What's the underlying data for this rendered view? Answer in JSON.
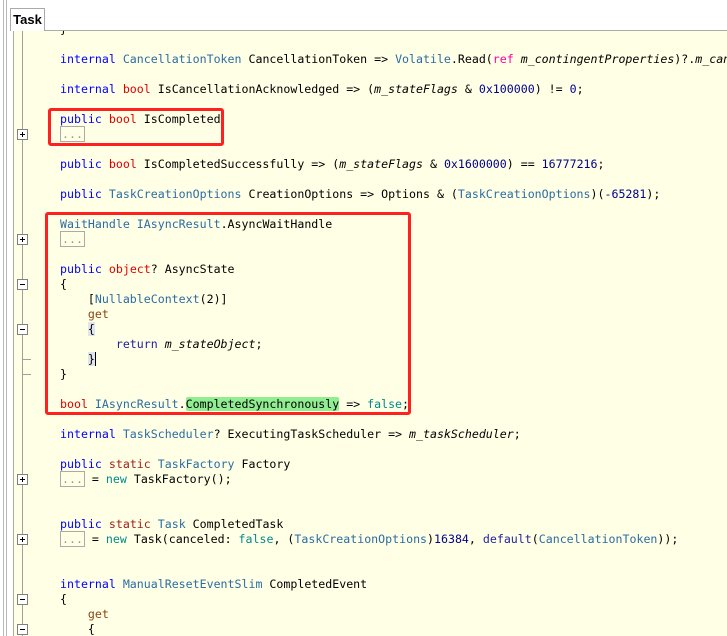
{
  "tab": {
    "label": "Task"
  },
  "colors": {
    "background": "#ffffe6",
    "highlight_box": "#ff2020",
    "match_highlight": "#90ee90"
  },
  "lines": [
    {
      "tokens": [
        [
          "}",
          "id"
        ]
      ]
    },
    {
      "tokens": []
    },
    {
      "tokens": [
        [
          "internal",
          "kw"
        ],
        [
          " ",
          "id"
        ],
        [
          "CancellationToken",
          "ty"
        ],
        [
          " CancellationToken => ",
          "id"
        ],
        [
          "Volatile",
          "ty"
        ],
        [
          ".Read(",
          "id"
        ],
        [
          "ref",
          "ref"
        ],
        [
          " ",
          "id"
        ],
        [
          "m_contingentProperties",
          "fld"
        ],
        [
          ")?.",
          "id"
        ],
        [
          "m_can",
          "fld"
        ]
      ]
    },
    {
      "tokens": []
    },
    {
      "tokens": [
        [
          "internal",
          "kw"
        ],
        [
          " ",
          "id"
        ],
        [
          "bool",
          "vt"
        ],
        [
          " IsCancellationAcknowledged => (",
          "id"
        ],
        [
          "m_stateFlags",
          "fld"
        ],
        [
          " & ",
          "id"
        ],
        [
          "0x100000",
          "num"
        ],
        [
          ") != ",
          "id"
        ],
        [
          "0",
          "num"
        ],
        [
          ";",
          "id"
        ]
      ]
    },
    {
      "tokens": []
    },
    {
      "tokens": [
        [
          "public",
          "kw"
        ],
        [
          " ",
          "id"
        ],
        [
          "bool",
          "vt"
        ],
        [
          " IsCompleted",
          "id"
        ]
      ]
    },
    {
      "fold": "plus",
      "tokens": [
        [
          "...",
          "coll"
        ]
      ]
    },
    {
      "tokens": []
    },
    {
      "tokens": [
        [
          "public",
          "kw"
        ],
        [
          " ",
          "id"
        ],
        [
          "bool",
          "vt"
        ],
        [
          " IsCompletedSuccessfully => (",
          "id"
        ],
        [
          "m_stateFlags",
          "fld"
        ],
        [
          " & ",
          "id"
        ],
        [
          "0x1600000",
          "num"
        ],
        [
          ") == ",
          "id"
        ],
        [
          "16777216",
          "num"
        ],
        [
          ";",
          "id"
        ]
      ]
    },
    {
      "tokens": []
    },
    {
      "tokens": [
        [
          "public",
          "kw"
        ],
        [
          " ",
          "id"
        ],
        [
          "TaskCreationOptions",
          "ty"
        ],
        [
          " CreationOptions => Options & (",
          "id"
        ],
        [
          "TaskCreationOptions",
          "ty"
        ],
        [
          ")(",
          "id"
        ],
        [
          "-65281",
          "num"
        ],
        [
          ");",
          "id"
        ]
      ]
    },
    {
      "tokens": []
    },
    {
      "tokens": [
        [
          "WaitHandle",
          "ty"
        ],
        [
          " ",
          "id"
        ],
        [
          "IAsyncResult",
          "ty"
        ],
        [
          ".AsyncWaitHandle",
          "id"
        ]
      ]
    },
    {
      "fold": "plus",
      "tokens": [
        [
          "...",
          "coll"
        ]
      ]
    },
    {
      "tokens": []
    },
    {
      "tokens": [
        [
          "public",
          "kw"
        ],
        [
          " ",
          "id"
        ],
        [
          "object",
          "vt"
        ],
        [
          "? AsyncState",
          "id"
        ]
      ]
    },
    {
      "fold": "minus",
      "tokens": [
        [
          "{",
          "id"
        ]
      ]
    },
    {
      "tokens": [
        [
          "    [",
          "id"
        ],
        [
          "NullableContext",
          "ty"
        ],
        [
          "(2)]",
          "id"
        ]
      ]
    },
    {
      "tokens": [
        [
          "    ",
          "id"
        ],
        [
          "get",
          "acc"
        ]
      ]
    },
    {
      "fold": "minus",
      "tokens": [
        [
          "    ",
          "id"
        ],
        [
          "{",
          "br"
        ]
      ]
    },
    {
      "tokens": [
        [
          "        ",
          "id"
        ],
        [
          "return",
          "ctl"
        ],
        [
          " ",
          "id"
        ],
        [
          "m_stateObject",
          "fld"
        ],
        [
          ";",
          "id"
        ]
      ]
    },
    {
      "fold": "tick",
      "tokens": [
        [
          "    ",
          "id"
        ],
        [
          "}",
          "br cursor"
        ]
      ]
    },
    {
      "fold": "tick",
      "tokens": [
        [
          "}",
          "id"
        ]
      ]
    },
    {
      "tokens": []
    },
    {
      "tokens": [
        [
          "bool",
          "vt"
        ],
        [
          " ",
          "id"
        ],
        [
          "IAsyncResult",
          "ty"
        ],
        [
          ".",
          "id"
        ],
        [
          "CompletedSynchronously",
          "hl"
        ],
        [
          " => ",
          "id"
        ],
        [
          "false",
          "lit"
        ],
        [
          ";",
          "id"
        ]
      ]
    },
    {
      "tokens": []
    },
    {
      "tokens": [
        [
          "internal",
          "kw"
        ],
        [
          " ",
          "id"
        ],
        [
          "TaskScheduler",
          "ty"
        ],
        [
          "? ExecutingTaskScheduler => ",
          "id"
        ],
        [
          "m_taskScheduler",
          "fld"
        ],
        [
          ";",
          "id"
        ]
      ]
    },
    {
      "tokens": []
    },
    {
      "tokens": [
        [
          "public",
          "kw"
        ],
        [
          " ",
          "id"
        ],
        [
          "static",
          "st"
        ],
        [
          " ",
          "id"
        ],
        [
          "TaskFactory",
          "ty"
        ],
        [
          " Factory",
          "id"
        ]
      ]
    },
    {
      "fold": "plus",
      "tokens": [
        [
          "...",
          "coll"
        ],
        [
          " = ",
          "id"
        ],
        [
          "new",
          "lit"
        ],
        [
          " ",
          "id"
        ],
        [
          "TaskFactory",
          "id"
        ],
        [
          "();",
          "id"
        ]
      ]
    },
    {
      "tokens": []
    },
    {
      "tokens": []
    },
    {
      "tokens": [
        [
          "public",
          "kw"
        ],
        [
          " ",
          "id"
        ],
        [
          "static",
          "st"
        ],
        [
          " ",
          "id"
        ],
        [
          "Task",
          "ty"
        ],
        [
          " CompletedTask",
          "id"
        ]
      ]
    },
    {
      "fold": "plus",
      "tokens": [
        [
          "...",
          "coll"
        ],
        [
          " = ",
          "id"
        ],
        [
          "new",
          "lit"
        ],
        [
          " ",
          "id"
        ],
        [
          "Task",
          "id"
        ],
        [
          "(canceled: ",
          "id"
        ],
        [
          "false",
          "lit"
        ],
        [
          ", (",
          "id"
        ],
        [
          "TaskCreationOptions",
          "ty"
        ],
        [
          ")",
          "id"
        ],
        [
          "16384",
          "num"
        ],
        [
          ", ",
          "id"
        ],
        [
          "default",
          "ctl"
        ],
        [
          "(",
          "id"
        ],
        [
          "CancellationToken",
          "ty"
        ],
        [
          "));",
          "id"
        ]
      ]
    },
    {
      "tokens": []
    },
    {
      "tokens": []
    },
    {
      "tokens": [
        [
          "internal",
          "kw"
        ],
        [
          " ",
          "id"
        ],
        [
          "ManualResetEventSlim",
          "ty"
        ],
        [
          " CompletedEvent",
          "id"
        ]
      ]
    },
    {
      "fold": "minus",
      "tokens": [
        [
          "{",
          "id"
        ]
      ]
    },
    {
      "tokens": [
        [
          "    ",
          "id"
        ],
        [
          "get",
          "acc"
        ]
      ]
    },
    {
      "fold": "minus",
      "tokens": [
        [
          "    {",
          "id"
        ]
      ]
    }
  ]
}
